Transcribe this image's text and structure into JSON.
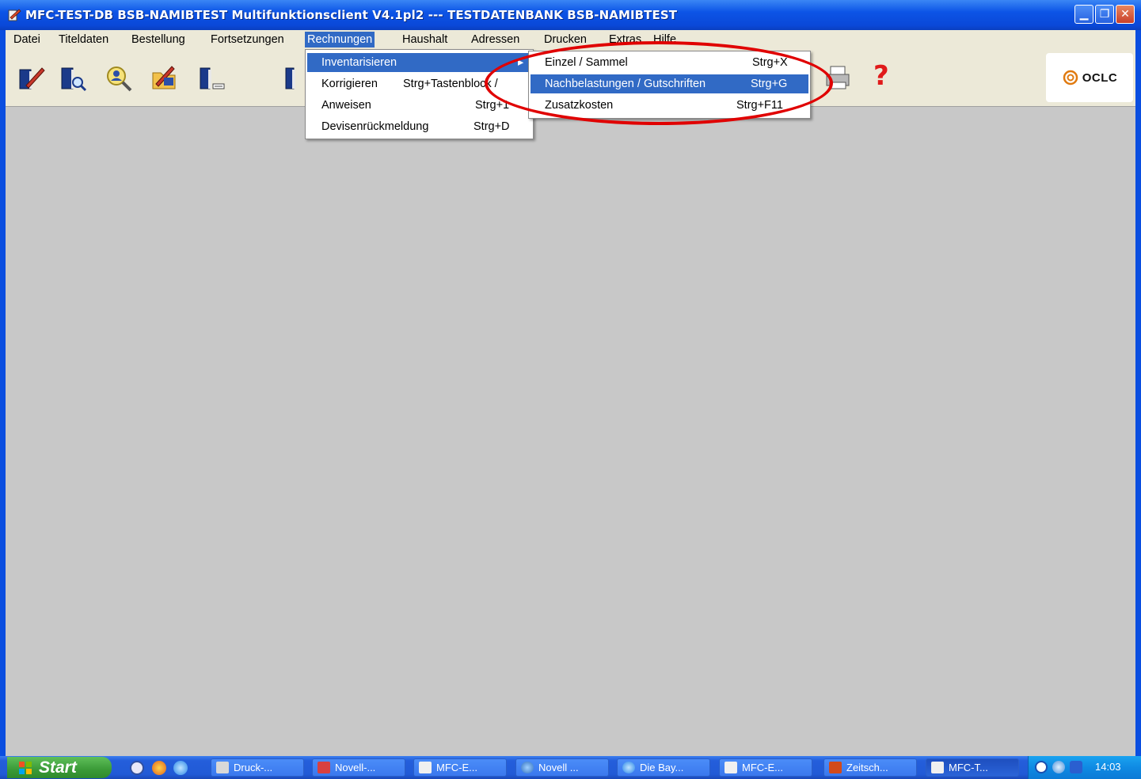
{
  "window": {
    "title": "MFC-TEST-DB BSB-NAMIBTEST Multifunktionsclient V4.1pl2 --- TESTDATENBANK BSB-NAMIBTEST"
  },
  "titlebar_buttons": {
    "minimize": "▁",
    "maximize": "❐",
    "close": "✕"
  },
  "menubar": {
    "items": [
      "Datei",
      "Titeldaten",
      "Bestellung",
      "Fortsetzungen",
      "Rechnungen",
      "Haushalt",
      "Adressen",
      "Drucken",
      "Extras",
      "Hilfe"
    ],
    "active": "Rechnungen"
  },
  "rechnungen_menu": {
    "items": [
      {
        "label": "Inventarisieren",
        "shortcut": ""
      },
      {
        "label": "Korrigieren",
        "shortcut": "Strg+Tastenblock /"
      },
      {
        "label": "Anweisen",
        "shortcut": "Strg+1"
      },
      {
        "label": "Devisenrückmeldung",
        "shortcut": "Strg+D"
      }
    ]
  },
  "inventarisieren_submenu": {
    "items": [
      {
        "label": "Einzel / Sammel",
        "shortcut": "Strg+X"
      },
      {
        "label": "Nachbelastungen / Gutschriften",
        "shortcut": "Strg+G"
      },
      {
        "label": "Zusatzkosten",
        "shortcut": "Strg+F11"
      }
    ],
    "highlighted": "Nachbelastungen / Gutschriften"
  },
  "toolbar": {
    "icons": [
      "book-edit-icon",
      "book-search-icon",
      "magnifier-person-icon",
      "folder-edit-icon",
      "book-list-icon",
      "book-icon",
      "printer-icon",
      "help-icon"
    ],
    "help_label": "?",
    "logo_text": "OCLC"
  },
  "taskbar": {
    "start_label": "Start",
    "buttons": [
      "Druck-...",
      "Novell-...",
      "MFC-E...",
      "Novell ...",
      "Die Bay...",
      "MFC-E...",
      "Zeitsch...",
      "MFC-T..."
    ],
    "active_button": "MFC-T...",
    "clock": "14:03"
  },
  "colors": {
    "highlight": "#316ac5",
    "annotation": "#e00000",
    "client_background": "#c8c8c8"
  }
}
